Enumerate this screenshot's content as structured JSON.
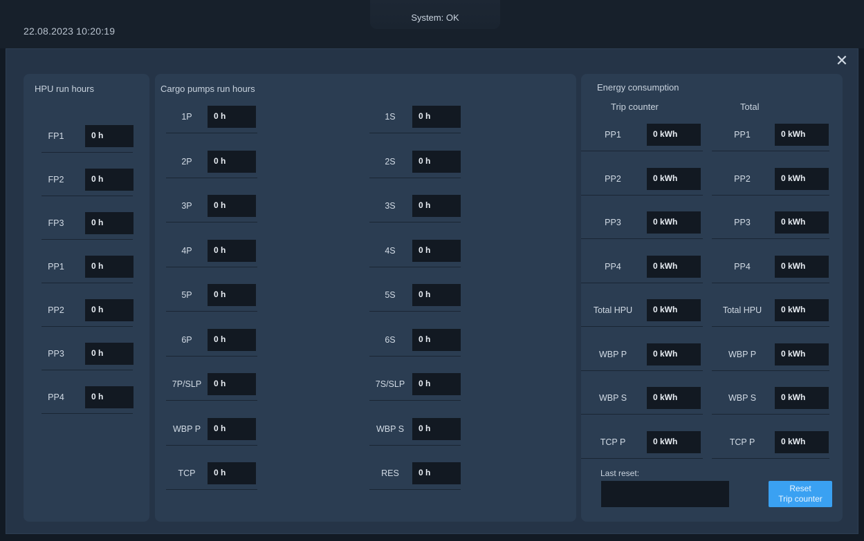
{
  "header": {
    "datetime": "22.08.2023 10:20:19",
    "status": "System: OK"
  },
  "dialog": {
    "close_icon": "close-icon"
  },
  "hpu": {
    "title": "HPU run hours",
    "rows": [
      {
        "label": "FP1",
        "value": "0 h"
      },
      {
        "label": "FP2",
        "value": "0 h"
      },
      {
        "label": "FP3",
        "value": "0 h"
      },
      {
        "label": "PP1",
        "value": "0 h"
      },
      {
        "label": "PP2",
        "value": "0 h"
      },
      {
        "label": "PP3",
        "value": "0 h"
      },
      {
        "label": "PP4",
        "value": "0 h"
      }
    ]
  },
  "cargo": {
    "title": "Cargo pumps run hours",
    "port": [
      {
        "label": "1P",
        "value": "0 h"
      },
      {
        "label": "2P",
        "value": "0 h"
      },
      {
        "label": "3P",
        "value": "0 h"
      },
      {
        "label": "4P",
        "value": "0 h"
      },
      {
        "label": "5P",
        "value": "0 h"
      },
      {
        "label": "6P",
        "value": "0 h"
      },
      {
        "label": "7P/SLP",
        "value": "0 h"
      },
      {
        "label": "WBP P",
        "value": "0 h"
      },
      {
        "label": "TCP",
        "value": "0 h"
      }
    ],
    "starboard": [
      {
        "label": "1S",
        "value": "0 h"
      },
      {
        "label": "2S",
        "value": "0 h"
      },
      {
        "label": "3S",
        "value": "0 h"
      },
      {
        "label": "4S",
        "value": "0 h"
      },
      {
        "label": "5S",
        "value": "0 h"
      },
      {
        "label": "6S",
        "value": "0 h"
      },
      {
        "label": "7S/SLP",
        "value": "0 h"
      },
      {
        "label": "WBP S",
        "value": "0 h"
      },
      {
        "label": "RES",
        "value": "0 h"
      }
    ]
  },
  "energy": {
    "title": "Energy consumption",
    "trip_title": "Trip counter",
    "total_title": "Total",
    "trip": [
      {
        "label": "PP1",
        "value": "0 kWh"
      },
      {
        "label": "PP2",
        "value": "0 kWh"
      },
      {
        "label": "PP3",
        "value": "0 kWh"
      },
      {
        "label": "PP4",
        "value": "0 kWh"
      },
      {
        "label": "Total HPU",
        "value": "0 kWh"
      },
      {
        "label": "WBP P",
        "value": "0 kWh"
      },
      {
        "label": "WBP S",
        "value": "0 kWh"
      },
      {
        "label": "TCP P",
        "value": "0 kWh"
      }
    ],
    "total": [
      {
        "label": "PP1",
        "value": "0 kWh"
      },
      {
        "label": "PP2",
        "value": "0 kWh"
      },
      {
        "label": "PP3",
        "value": "0 kWh"
      },
      {
        "label": "PP4",
        "value": "0 kWh"
      },
      {
        "label": "Total HPU",
        "value": "0 kWh"
      },
      {
        "label": "WBP P",
        "value": "0 kWh"
      },
      {
        "label": "WBP S",
        "value": "0 kWh"
      },
      {
        "label": "TCP P",
        "value": "0 kWh"
      }
    ],
    "last_reset_label": "Last reset:",
    "last_reset_value": "",
    "reset_button": [
      "Reset",
      "Trip counter"
    ]
  }
}
